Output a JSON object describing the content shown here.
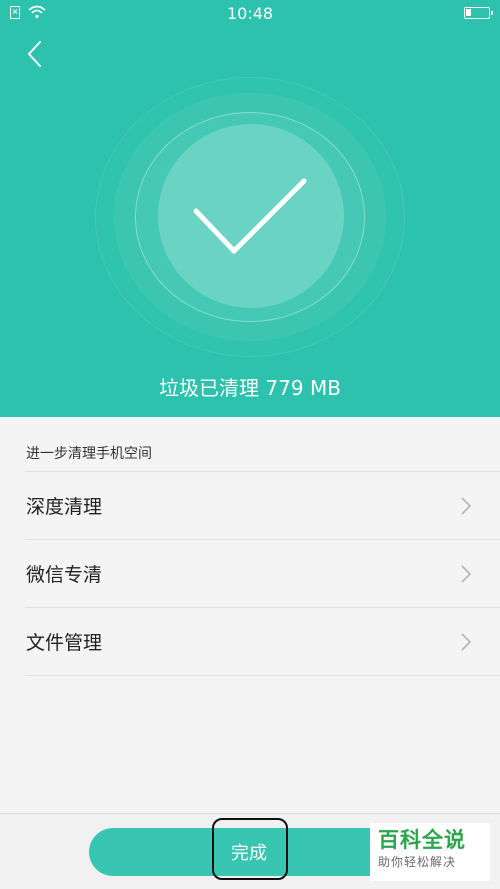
{
  "status_bar": {
    "time": "10:48",
    "sim_glyph": "×",
    "battery_level": 0.25,
    "icons": [
      "sim-icon",
      "wifi-icon",
      "battery-icon"
    ]
  },
  "header": {
    "back_icon": "chevron-left-icon",
    "success_icon": "checkmark-icon",
    "cleaned_text": "垃圾已清理 779 MB",
    "background_color": "#2cc2ad"
  },
  "section": {
    "title": "进一步清理手机空间"
  },
  "list": [
    {
      "label": "深度清理"
    },
    {
      "label": "微信专清"
    },
    {
      "label": "文件管理"
    }
  ],
  "footer": {
    "done_label": "完成",
    "button_color": "#38c6b2"
  },
  "watermark": {
    "main": "百科全说",
    "sub": "助你轻松解决"
  }
}
